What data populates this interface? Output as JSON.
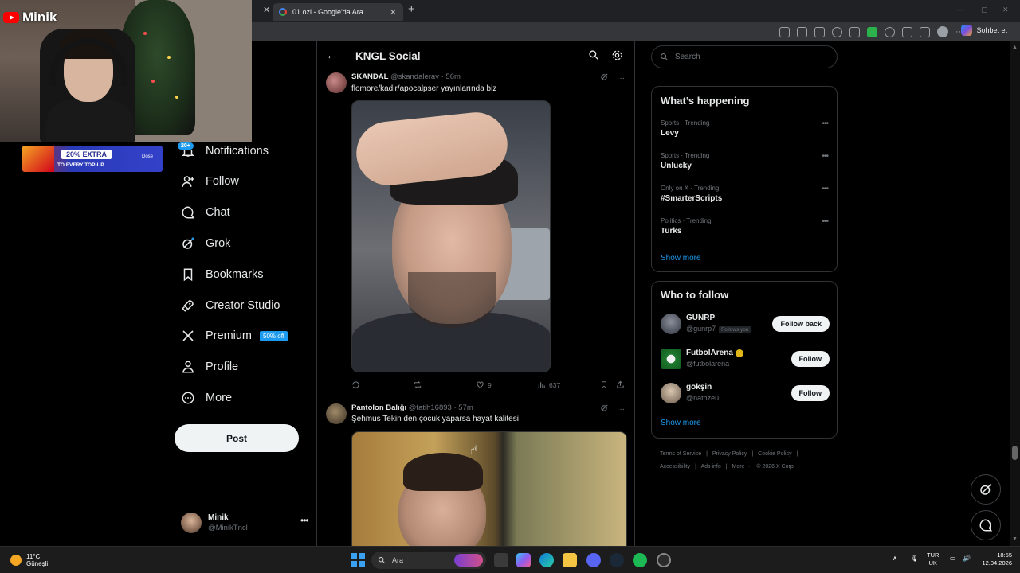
{
  "browser": {
    "active_tab_title": "01 ozi - Google'da Ara",
    "copilot_label": "Sohbet et"
  },
  "overlay": {
    "channel_name": "Minik",
    "promo_headline": "20% EXTRA",
    "promo_subline": "TO EVERY TOP-UP",
    "promo_brand": "Dose"
  },
  "sidebar": {
    "notifications_badge": "20+",
    "items": [
      {
        "label": "Notifications",
        "icon": "bell-icon"
      },
      {
        "label": "Follow",
        "icon": "follow-icon"
      },
      {
        "label": "Chat",
        "icon": "chat-icon"
      },
      {
        "label": "Grok",
        "icon": "grok-icon"
      },
      {
        "label": "Bookmarks",
        "icon": "bookmark-icon"
      },
      {
        "label": "Creator Studio",
        "icon": "rocket-icon"
      },
      {
        "label": "Premium",
        "icon": "x-logo-icon"
      },
      {
        "label": "Profile",
        "icon": "person-icon"
      },
      {
        "label": "More",
        "icon": "more-circle-icon"
      }
    ],
    "premium_badge": "50% off",
    "post_button": "Post",
    "profile": {
      "name": "Minik",
      "handle": "@MinikTncl"
    }
  },
  "main": {
    "title": "KNGL Social",
    "posts": [
      {
        "name": "SKANDAL",
        "handle": "@skandaleray",
        "time": "· 56m",
        "text": "flomore/kadir/apocalpser yayınlarında biz",
        "stats": {
          "replies": "",
          "reposts": "",
          "likes": "9",
          "views": "637"
        }
      },
      {
        "name": "Pantolon Balığı",
        "handle": "@fatih16893",
        "time": "· 57m",
        "text": "Şehmus Tekin den çocuk yaparsa hayat kalitesi"
      }
    ]
  },
  "right": {
    "search_placeholder": "Search",
    "trends_title": "What’s happening",
    "trends": [
      {
        "category": "Sports · Trending",
        "name": "Levy"
      },
      {
        "category": "Sports · Trending",
        "name": "Unlucky"
      },
      {
        "category": "Only on X · Trending",
        "name": "#SmarterScripts"
      },
      {
        "category": "Politics · Trending",
        "name": "Turks"
      }
    ],
    "show_more": "Show more",
    "who_to_follow_title": "Who to follow",
    "suggestions": [
      {
        "name": "GUNRP",
        "handle": "@gunrp7",
        "follows_you": "Follows you",
        "button": "Follow back"
      },
      {
        "name": "FutbolArena",
        "handle": "@futbolarena",
        "button": "Follow"
      },
      {
        "name": "gökşin",
        "handle": "@nathzeu",
        "button": "Follow"
      }
    ],
    "footer": [
      "Terms of Service",
      "|",
      "Privacy Policy",
      "|",
      "Cookie Policy",
      "|",
      "Accessibility",
      "|",
      "Ads info",
      "|",
      "More ···",
      "© 2026 X Corp."
    ]
  },
  "taskbar": {
    "weather_temp": "11°C",
    "weather_desc": "Güneşli",
    "search_label": "Ara",
    "lang_top": "TUR",
    "lang_bottom": "UK",
    "time": "18:55",
    "date": "12.04.2026"
  },
  "colors": {
    "accent": "#1d9bf0",
    "background": "#000000",
    "border": "#2f3336",
    "muted": "#71767b"
  }
}
